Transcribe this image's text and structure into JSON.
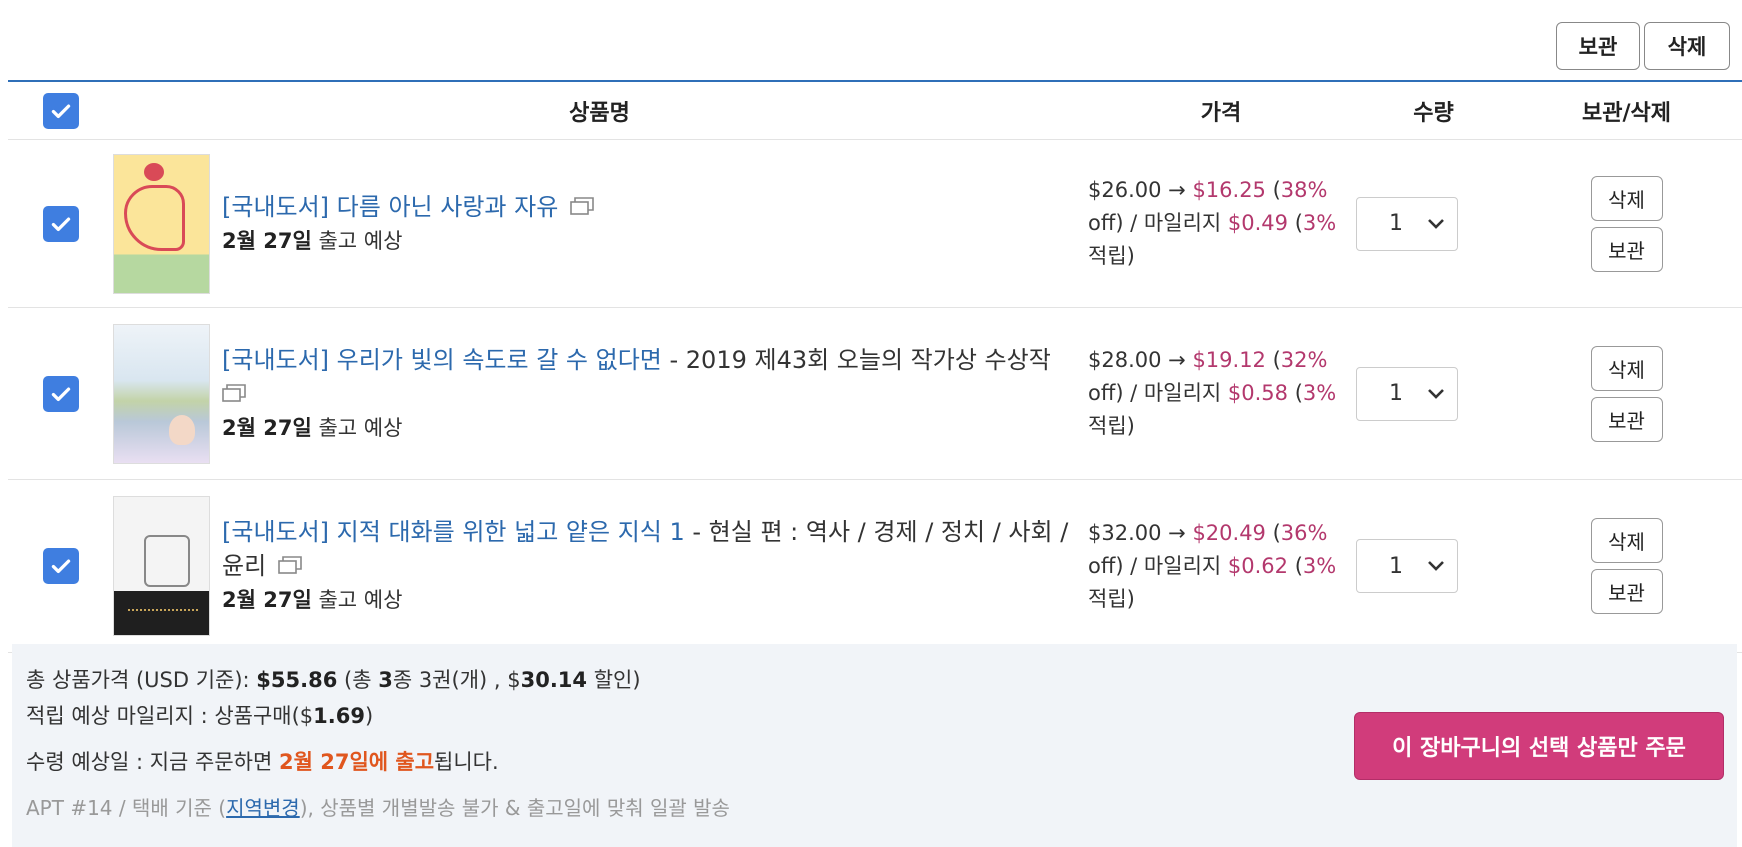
{
  "top_actions": {
    "keep_label": "보관",
    "delete_label": "삭제"
  },
  "header": {
    "name": "상품명",
    "price": "가격",
    "qty": "수량",
    "actions": "보관/삭제"
  },
  "items": [
    {
      "title_link": "[국내도서] 다름 아닌 사랑과 자유",
      "title_sub": "",
      "ship_date": "2월 27일",
      "ship_suffix": " 출고 예상",
      "list_price": "$26.00",
      "arrow": " → ",
      "sale_price": "$16.25",
      "discount": "38%",
      "mileage_label": " off) / 마일리지 ",
      "mileage": "$0.49",
      "mileage_rate": "3%",
      "mileage_suffix": " 적립)",
      "qty": "1",
      "delete_label": "삭제",
      "keep_label": "보관"
    },
    {
      "title_link": "[국내도서] 우리가 빛의 속도로 갈 수 없다면",
      "title_sub": " - 2019 제43회 오늘의 작가상 수상작",
      "ship_date": "2월 27일",
      "ship_suffix": " 출고 예상",
      "list_price": "$28.00",
      "arrow": " → ",
      "sale_price": "$19.12",
      "discount": "32%",
      "mileage_label": " off) / 마일리지 ",
      "mileage": "$0.58",
      "mileage_rate": "3%",
      "mileage_suffix": " 적립)",
      "qty": "1",
      "delete_label": "삭제",
      "keep_label": "보관"
    },
    {
      "title_link": "[국내도서] 지적 대화를 위한 넓고 얕은 지식 1",
      "title_sub": " - 현실 편 : 역사 / 경제 / 정치 / 사회 / 윤리",
      "ship_date": "2월 27일",
      "ship_suffix": " 출고 예상",
      "list_price": "$32.00",
      "arrow": " → ",
      "sale_price": "$20.49",
      "discount": "36%",
      "mileage_label": " off) / 마일리지 ",
      "mileage": "$0.62",
      "mileage_rate": "3%",
      "mileage_suffix": " 적립)",
      "qty": "1",
      "delete_label": "삭제",
      "keep_label": "보관"
    }
  ],
  "summary": {
    "total_label": "총 상품가격 (USD 기준): ",
    "total": "$55.86",
    "count_pre": " (총 ",
    "count_kinds": "3",
    "count_mid": "종 3권(개) , $",
    "discount_total": "30.14",
    "discount_suffix": " 할인)",
    "mileage_label": "적립 예상 마일리지 : 상품구매($",
    "mileage_total": "1.69",
    "mileage_suffix": ")",
    "receive_label": "수령 예상일 : 지금 주문하면 ",
    "receive_date": "2월 27일에 출고",
    "receive_suffix": "됩니다.",
    "delivery_pre": "APT #14 / 택배 기준 (",
    "delivery_link": "지역변경",
    "delivery_post": "), 상품별 개별발송 불가 & 출고일에 맞춰 일괄 발송",
    "order_button": "이 장바구니의 선택 상품만 주문"
  },
  "colors": {
    "accent_blue": "#2c69ad",
    "checkbox": "#3f7ee0",
    "price_pink": "#b3386d",
    "ship_orange": "#e0561e",
    "order_button": "#d13c7b"
  }
}
